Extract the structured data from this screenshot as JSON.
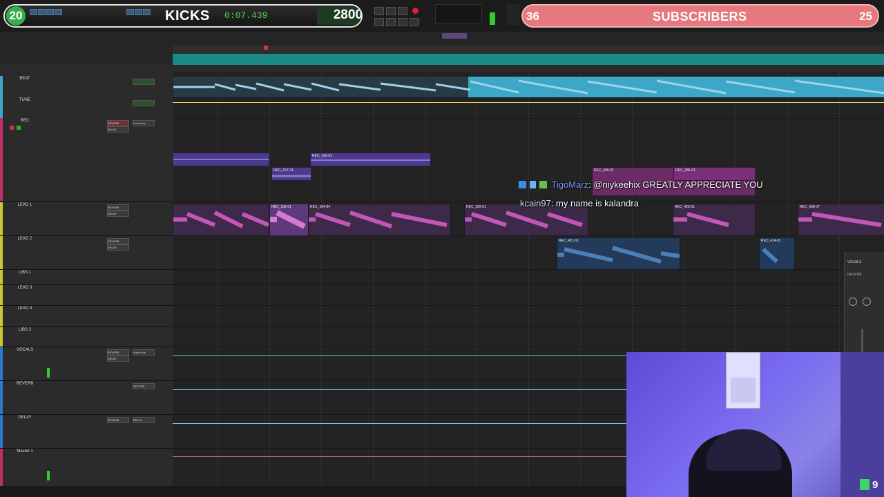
{
  "stream_overlay": {
    "kicks": {
      "count": "20",
      "label": "KICKS",
      "value": "2800"
    },
    "subscribers": {
      "left_count": "36",
      "label": "SUBSCRIBERS",
      "right_count": "25"
    },
    "corner_count": "9"
  },
  "transport": {
    "counter": "0:07.439"
  },
  "chat": [
    {
      "user": "TigoMarz",
      "message": ": @niykeehix GREATLY APPRECIATE YOU"
    },
    {
      "user": "kcain97",
      "message": ": my name is kalandra"
    }
  ],
  "tracks": [
    {
      "name": "BEAT",
      "color": "#3da7c8"
    },
    {
      "name": "TUNE",
      "color": "#3da7c8"
    },
    {
      "name": "REC",
      "color": "#c0306a"
    },
    {
      "name": "LEAD 1",
      "color": "#c8c830"
    },
    {
      "name": "LEAD 2",
      "color": "#c8c830"
    },
    {
      "name": "LIBS 1",
      "color": "#c8c830"
    },
    {
      "name": "LEAD 3",
      "color": "#c8c830"
    },
    {
      "name": "LEAD 4",
      "color": "#c8c830"
    },
    {
      "name": "LIBS 2",
      "color": "#c8c830"
    },
    {
      "name": "VOCALS",
      "color": "#2a7bc8"
    },
    {
      "name": "REVERB",
      "color": "#2a7bc8"
    },
    {
      "name": "DELAY",
      "color": "#2a7bc8"
    },
    {
      "name": "Master 1",
      "color": "#c03060"
    }
  ],
  "plugins": {
    "reverb": "REVERB",
    "delay": "DELAY",
    "vocal_bus": "Vocal Bus"
  },
  "clips": [
    {
      "name": "REC_157-01"
    },
    {
      "name": "REC_165-01"
    },
    {
      "name": "REC_183-01"
    },
    {
      "name": "REC_184-84"
    },
    {
      "name": "REC_389-01"
    },
    {
      "name": "REC_406-01"
    },
    {
      "name": "REC_386-01"
    },
    {
      "name": "REC_421-01"
    },
    {
      "name": "REC_423-01"
    },
    {
      "name": "REC_414-01"
    },
    {
      "name": "REC_608-07"
    }
  ],
  "mixer_popup": {
    "title": "VOCALS",
    "insert": "REVERB"
  },
  "colors": {
    "beat": "#4ab2d6",
    "rec_purple": "#5a3a9a",
    "lead1_pink": "#c456b8",
    "lead2_blue": "#4b7fb8",
    "ruler": "#1b8a86"
  }
}
